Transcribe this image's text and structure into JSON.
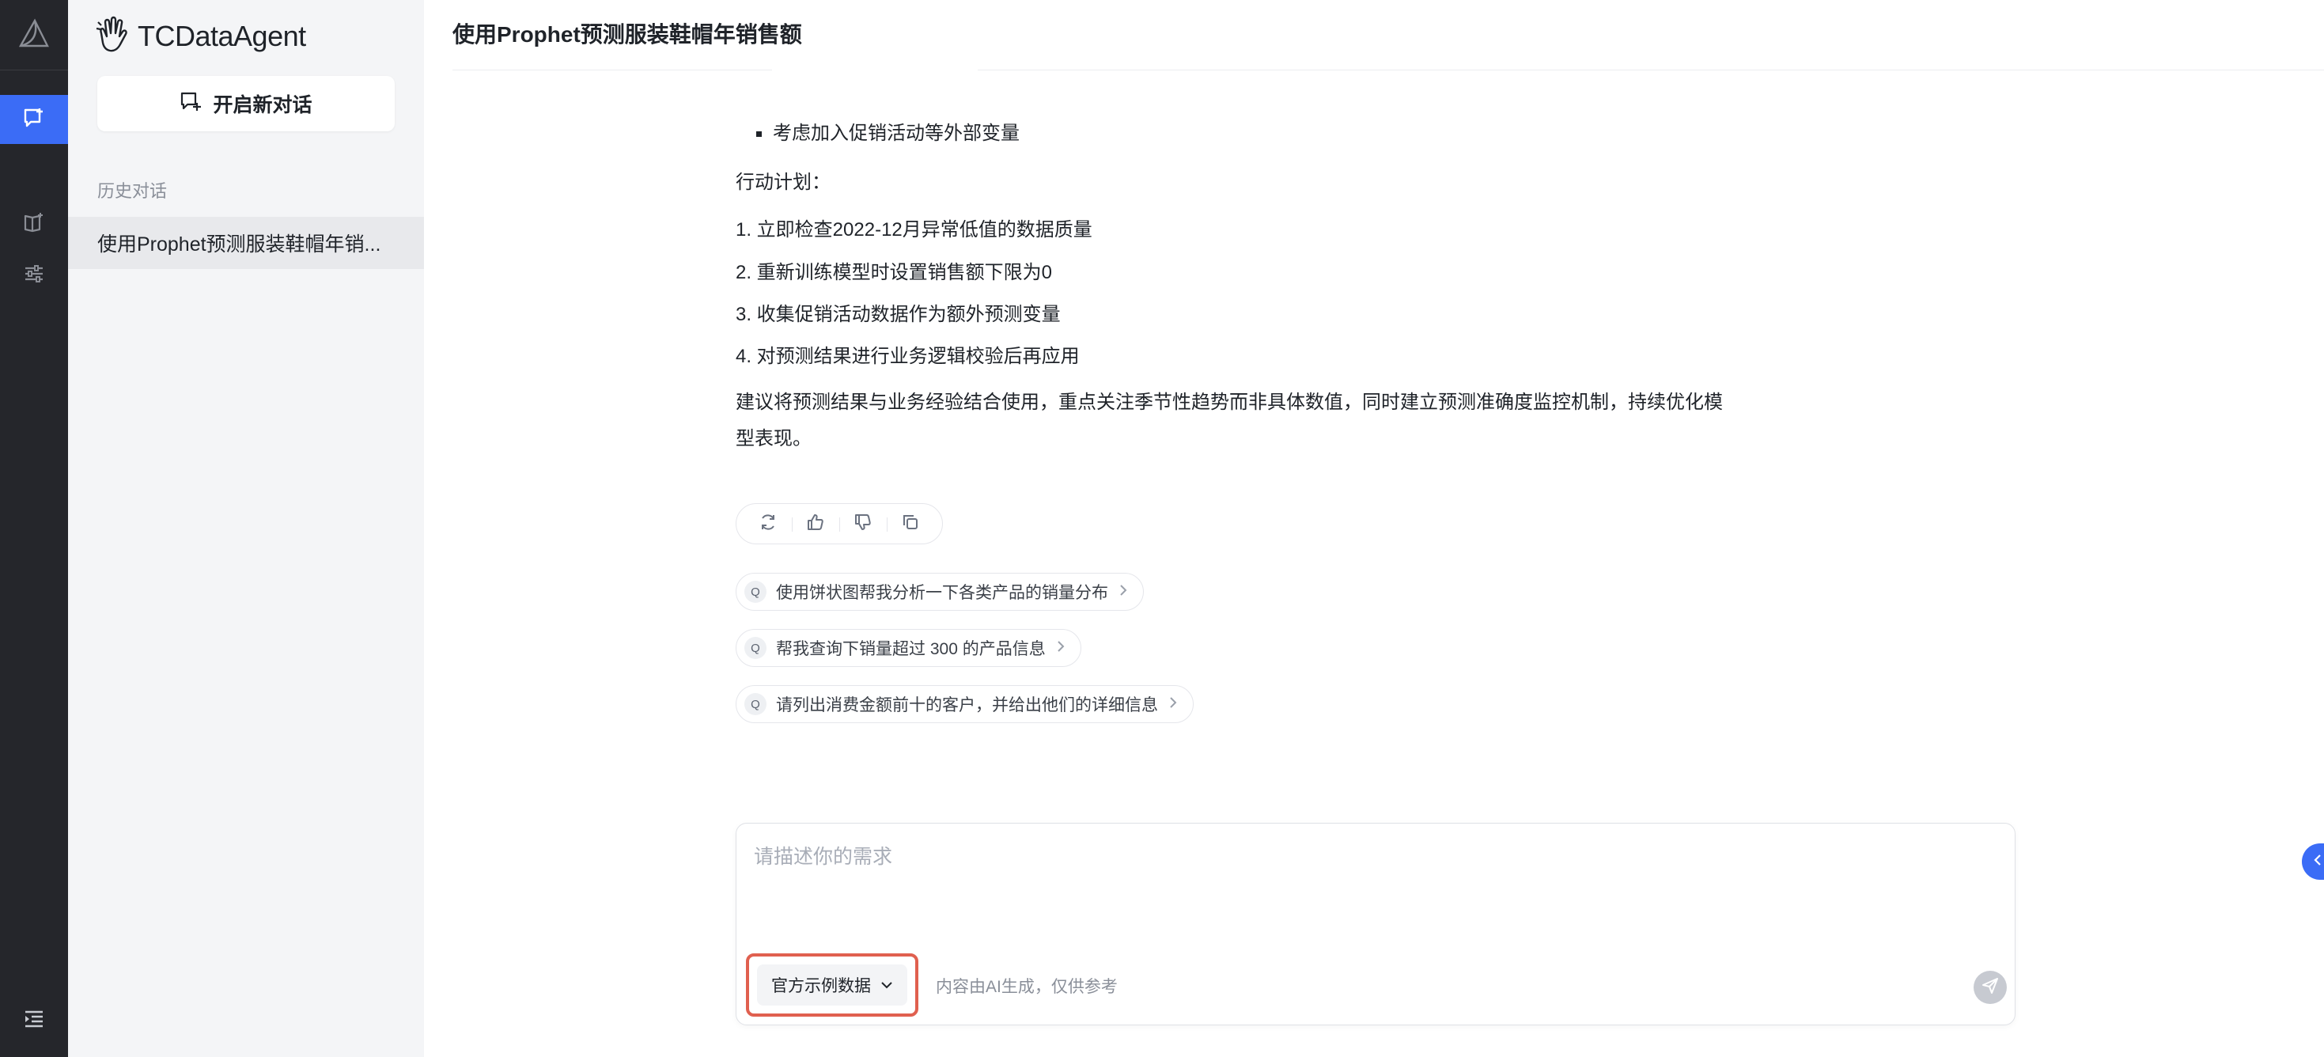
{
  "app": {
    "brand_name": "TCDataAgent"
  },
  "sidebar": {
    "new_chat_label": "开启新对话",
    "history_title": "历史对话",
    "history_items": [
      {
        "label": "使用Prophet预测服装鞋帽年销..."
      }
    ]
  },
  "rail": {
    "icons": [
      "logo-icon",
      "chat-icon",
      "book-icon",
      "sliders-icon",
      "menu-collapse-icon"
    ],
    "accent": "#3b6cf6"
  },
  "main": {
    "title": "使用Prophet预测服装鞋帽年销售额",
    "answer": {
      "bullets": [
        "考虑加入促销活动等外部变量"
      ],
      "action_title": "行动计划：",
      "action_items": [
        "1. 立即检查2022-12月异常低值的数据质量",
        "2. 重新训练模型时设置销售额下限为0",
        "3. 收集促销活动数据作为额外预测变量",
        "4. 对预测结果进行业务逻辑校验后再应用"
      ],
      "conclusion": "建议将预测结果与业务经验结合使用，重点关注季节性趋势而非具体数值，同时建立预测准确度监控机制，持续优化模型表现。"
    },
    "actions": [
      "refresh-icon",
      "thumbs-up-icon",
      "thumbs-down-icon",
      "copy-icon"
    ],
    "suggestions": [
      {
        "badge": "Q",
        "text": "使用饼状图帮我分析一下各类产品的销量分布"
      },
      {
        "badge": "Q",
        "text": "帮我查询下销量超过 300 的产品信息"
      },
      {
        "badge": "Q",
        "text": "请列出消费金额前十的客户，并给出他们的详细信息"
      }
    ]
  },
  "composer": {
    "placeholder": "请描述你的需求",
    "value": "",
    "dataset_label": "官方示例数据",
    "disclaimer": "内容由AI生成，仅供参考"
  },
  "colors": {
    "highlight_border": "#e0604f",
    "send_disabled": "#c7cad1"
  }
}
